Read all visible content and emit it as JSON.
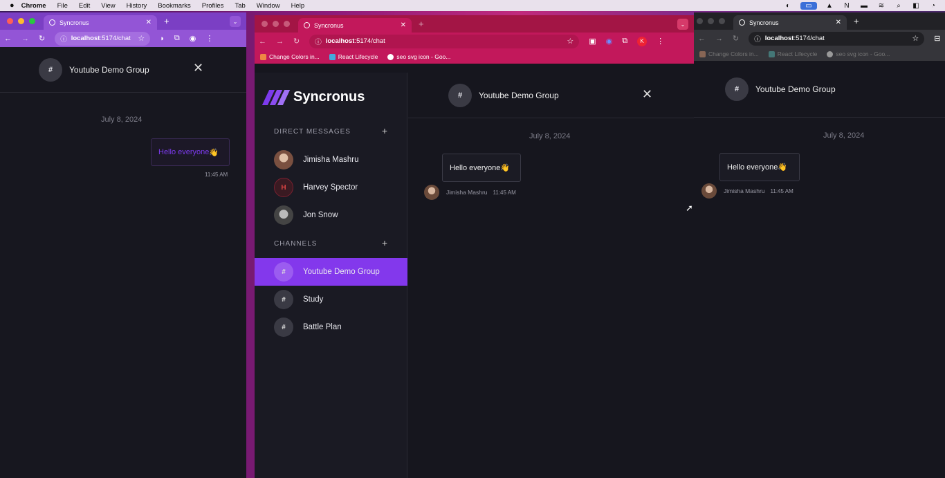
{
  "menubar": {
    "apple": "",
    "app": "Chrome",
    "items": [
      "File",
      "Edit",
      "View",
      "History",
      "Bookmarks",
      "Profiles",
      "Tab",
      "Window",
      "Help"
    ]
  },
  "colors": {
    "accent": "#8338ec",
    "left_frame": "#7b3fc4",
    "middle_frame": "#c2185b",
    "right_frame": "#2b2b30"
  },
  "browser": {
    "tab_title": "Syncronus",
    "url_host": "localhost",
    "url_path": ":5174/chat",
    "bookmarks": [
      "Change Colors in...",
      "React Lifecycle",
      "seo svg icon - Goo..."
    ]
  },
  "chat": {
    "channel_name": "Youtube Demo Group",
    "channel_icon": "#",
    "date": "July 8, 2024",
    "message": "Hello everyone",
    "emoji": "👋",
    "sender": "Jimisha Mashru",
    "time": "11:45 AM"
  },
  "app": {
    "name": "Syncronus",
    "dm_header": "DIRECT MESSAGES",
    "channels_header": "CHANNELS",
    "contacts": [
      {
        "name": "Jimisha Mashru",
        "initial": ""
      },
      {
        "name": "Harvey Spector",
        "initial": "H"
      },
      {
        "name": "Jon Snow",
        "initial": ""
      }
    ],
    "channels": [
      {
        "name": "Youtube Demo Group"
      },
      {
        "name": "Study"
      },
      {
        "name": "Battle Plan"
      }
    ]
  }
}
